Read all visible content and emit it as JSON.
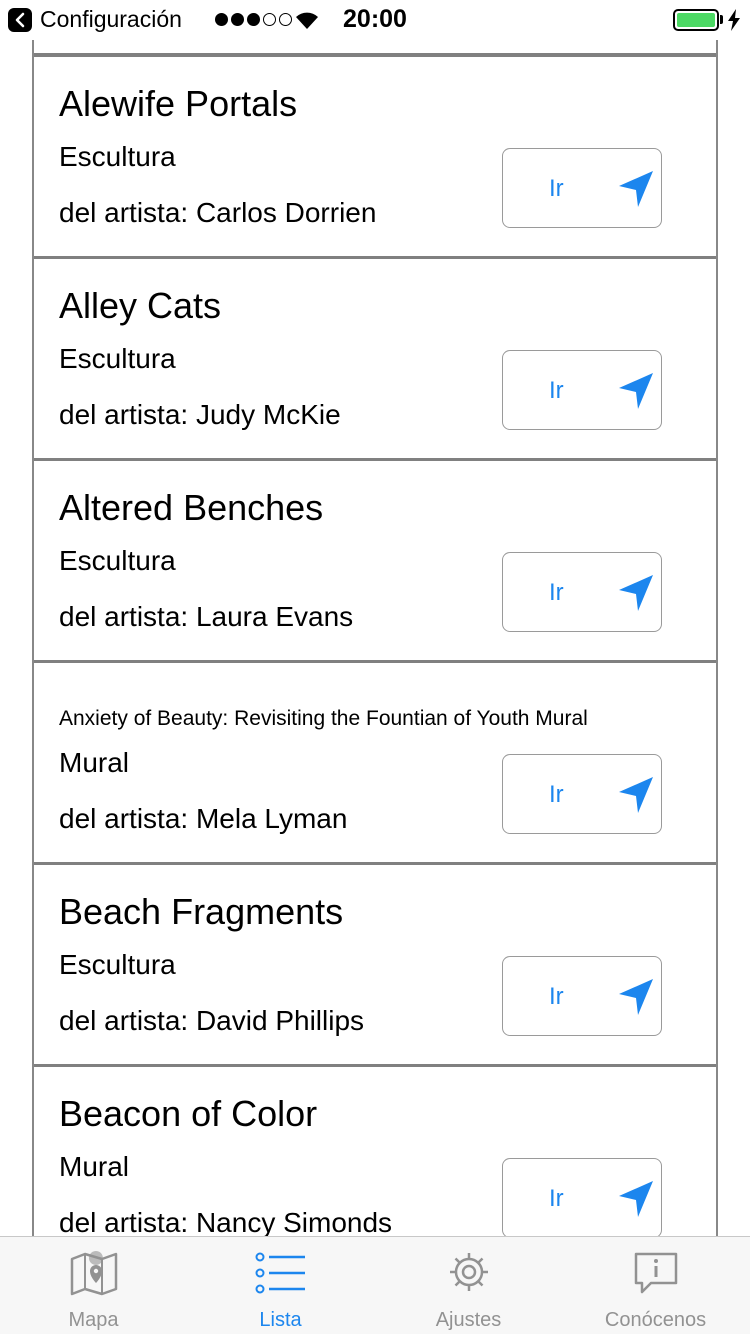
{
  "status_bar": {
    "back_label": "Configuración",
    "time": "20:00",
    "signal_strength": 3,
    "battery_color": "#4cd964"
  },
  "accent_color": "#1c86ee",
  "list": {
    "items": [
      {
        "title": "Alewife Portals",
        "type": "Escultura",
        "artist": "del artista: Carlos Dorrien",
        "go_label": "Ir"
      },
      {
        "title": "Alley Cats",
        "type": "Escultura",
        "artist": "del artista: Judy McKie",
        "go_label": "Ir"
      },
      {
        "title": "Altered Benches",
        "type": "Escultura",
        "artist": "del artista: Laura Evans",
        "go_label": "Ir"
      },
      {
        "title": "Anxiety of Beauty: Revisiting the Fountian of Youth Mural",
        "type": "Mural",
        "artist": "del artista: Mela Lyman",
        "go_label": "Ir"
      },
      {
        "title": "Beach Fragments",
        "type": "Escultura",
        "artist": "del artista: David Phillips",
        "go_label": "Ir"
      },
      {
        "title": "Beacon of Color",
        "type": "Mural",
        "artist": "del artista: Nancy Simonds",
        "go_label": "Ir"
      }
    ]
  },
  "tab_bar": {
    "tabs": [
      {
        "label": "Mapa",
        "icon": "map-icon",
        "active": false
      },
      {
        "label": "Lista",
        "icon": "list-icon",
        "active": true
      },
      {
        "label": "Ajustes",
        "icon": "gear-icon",
        "active": false
      },
      {
        "label": "Conócenos",
        "icon": "info-bubble-icon",
        "active": false
      }
    ]
  }
}
